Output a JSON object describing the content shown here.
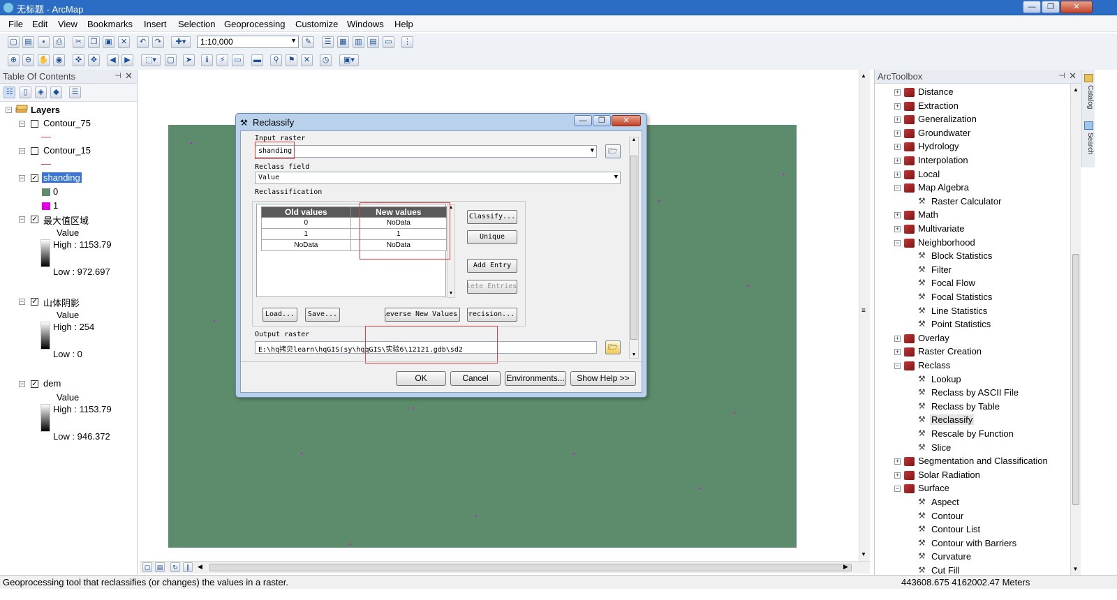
{
  "window": {
    "title": "无标题 - ArcMap",
    "controls": [
      "—",
      "❐",
      "✕"
    ]
  },
  "menu": [
    "File",
    "Edit",
    "View",
    "Bookmarks",
    "Insert",
    "Selection",
    "Geoprocessing",
    "Customize",
    "Windows",
    "Help"
  ],
  "toolbar": {
    "scale": "1:10,000"
  },
  "toc": {
    "title": "Table Of Contents",
    "pin": "⊣",
    "close": "✕",
    "root": "Layers",
    "layers": [
      {
        "name": "Contour_75",
        "checked": false
      },
      {
        "name": "Contour_15",
        "checked": false
      },
      {
        "name": "shanding",
        "checked": true,
        "classes": [
          "0",
          "1"
        ],
        "class_colors": [
          "#5c8c6b",
          "#e000e0"
        ]
      },
      {
        "name": "最大值区域",
        "checked": true,
        "field": "Value",
        "high": "High : 1153.79",
        "low": "Low : 972.697"
      },
      {
        "name": "山体阴影",
        "checked": true,
        "field": "Value",
        "high": "High : 254",
        "low": "Low : 0"
      },
      {
        "name": "dem",
        "checked": true,
        "field": "Value",
        "high": "High : 1153.79",
        "low": "Low : 946.372"
      }
    ]
  },
  "map": {
    "raster_color": "#5c8c6b"
  },
  "dialog": {
    "title": "Reclassify",
    "input_raster_label": "Input raster",
    "input_raster_value": "shanding",
    "reclass_field_label": "Reclass field",
    "reclass_field_value": "Value",
    "reclassification_label": "Reclassification",
    "columns": [
      "Old values",
      "New values"
    ],
    "rows": [
      {
        "old": "0",
        "new": "NoData"
      },
      {
        "old": "1",
        "new": "1"
      },
      {
        "old": "NoData",
        "new": "NoData"
      }
    ],
    "side_buttons": [
      "Classify...",
      "Unique",
      "Add Entry",
      "Delete Entries"
    ],
    "bottom_buttons": [
      "Load...",
      "Save...",
      "Reverse New Values",
      "Precision..."
    ],
    "output_raster_label": "Output raster",
    "output_raster_value": "E:\\hq拷贝learn\\hqGIS(sy\\hqqGIS\\实验6\\12121.gdb\\sd2",
    "action_buttons": [
      "OK",
      "Cancel",
      "Environments...",
      "Show Help >>"
    ]
  },
  "arctoolbox": {
    "title": "ArcToolbox",
    "items": [
      {
        "label": "Distance",
        "kind": "toolbox",
        "expanded": false
      },
      {
        "label": "Extraction",
        "kind": "toolbox",
        "expanded": false
      },
      {
        "label": "Generalization",
        "kind": "toolbox",
        "expanded": false
      },
      {
        "label": "Groundwater",
        "kind": "toolbox",
        "expanded": false
      },
      {
        "label": "Hydrology",
        "kind": "toolbox",
        "expanded": false
      },
      {
        "label": "Interpolation",
        "kind": "toolbox",
        "expanded": false
      },
      {
        "label": "Local",
        "kind": "toolbox",
        "expanded": false
      },
      {
        "label": "Map Algebra",
        "kind": "toolbox",
        "expanded": true
      },
      {
        "label": "Raster Calculator",
        "kind": "tool"
      },
      {
        "label": "Math",
        "kind": "toolbox",
        "expanded": false
      },
      {
        "label": "Multivariate",
        "kind": "toolbox",
        "expanded": false
      },
      {
        "label": "Neighborhood",
        "kind": "toolbox",
        "expanded": true
      },
      {
        "label": "Block Statistics",
        "kind": "tool"
      },
      {
        "label": "Filter",
        "kind": "tool"
      },
      {
        "label": "Focal Flow",
        "kind": "tool"
      },
      {
        "label": "Focal Statistics",
        "kind": "tool"
      },
      {
        "label": "Line Statistics",
        "kind": "tool"
      },
      {
        "label": "Point Statistics",
        "kind": "tool"
      },
      {
        "label": "Overlay",
        "kind": "toolbox",
        "expanded": false
      },
      {
        "label": "Raster Creation",
        "kind": "toolbox",
        "expanded": false
      },
      {
        "label": "Reclass",
        "kind": "toolbox",
        "expanded": true
      },
      {
        "label": "Lookup",
        "kind": "tool"
      },
      {
        "label": "Reclass by ASCII File",
        "kind": "tool"
      },
      {
        "label": "Reclass by Table",
        "kind": "tool"
      },
      {
        "label": "Reclassify",
        "kind": "tool",
        "selected": true
      },
      {
        "label": "Rescale by Function",
        "kind": "tool"
      },
      {
        "label": "Slice",
        "kind": "tool"
      },
      {
        "label": "Segmentation and Classification",
        "kind": "toolbox",
        "expanded": false
      },
      {
        "label": "Solar Radiation",
        "kind": "toolbox",
        "expanded": false
      },
      {
        "label": "Surface",
        "kind": "toolbox",
        "expanded": true
      },
      {
        "label": "Aspect",
        "kind": "tool"
      },
      {
        "label": "Contour",
        "kind": "tool"
      },
      {
        "label": "Contour List",
        "kind": "tool"
      },
      {
        "label": "Contour with Barriers",
        "kind": "tool"
      },
      {
        "label": "Curvature",
        "kind": "tool"
      },
      {
        "label": "Cut Fill",
        "kind": "tool"
      }
    ]
  },
  "side_tabs": [
    "Catalog",
    "Search"
  ],
  "status": {
    "message": "Geoprocessing tool that reclassifies (or changes) the values in a raster.",
    "coordinates": "443608.675  4162002.47 Meters"
  }
}
